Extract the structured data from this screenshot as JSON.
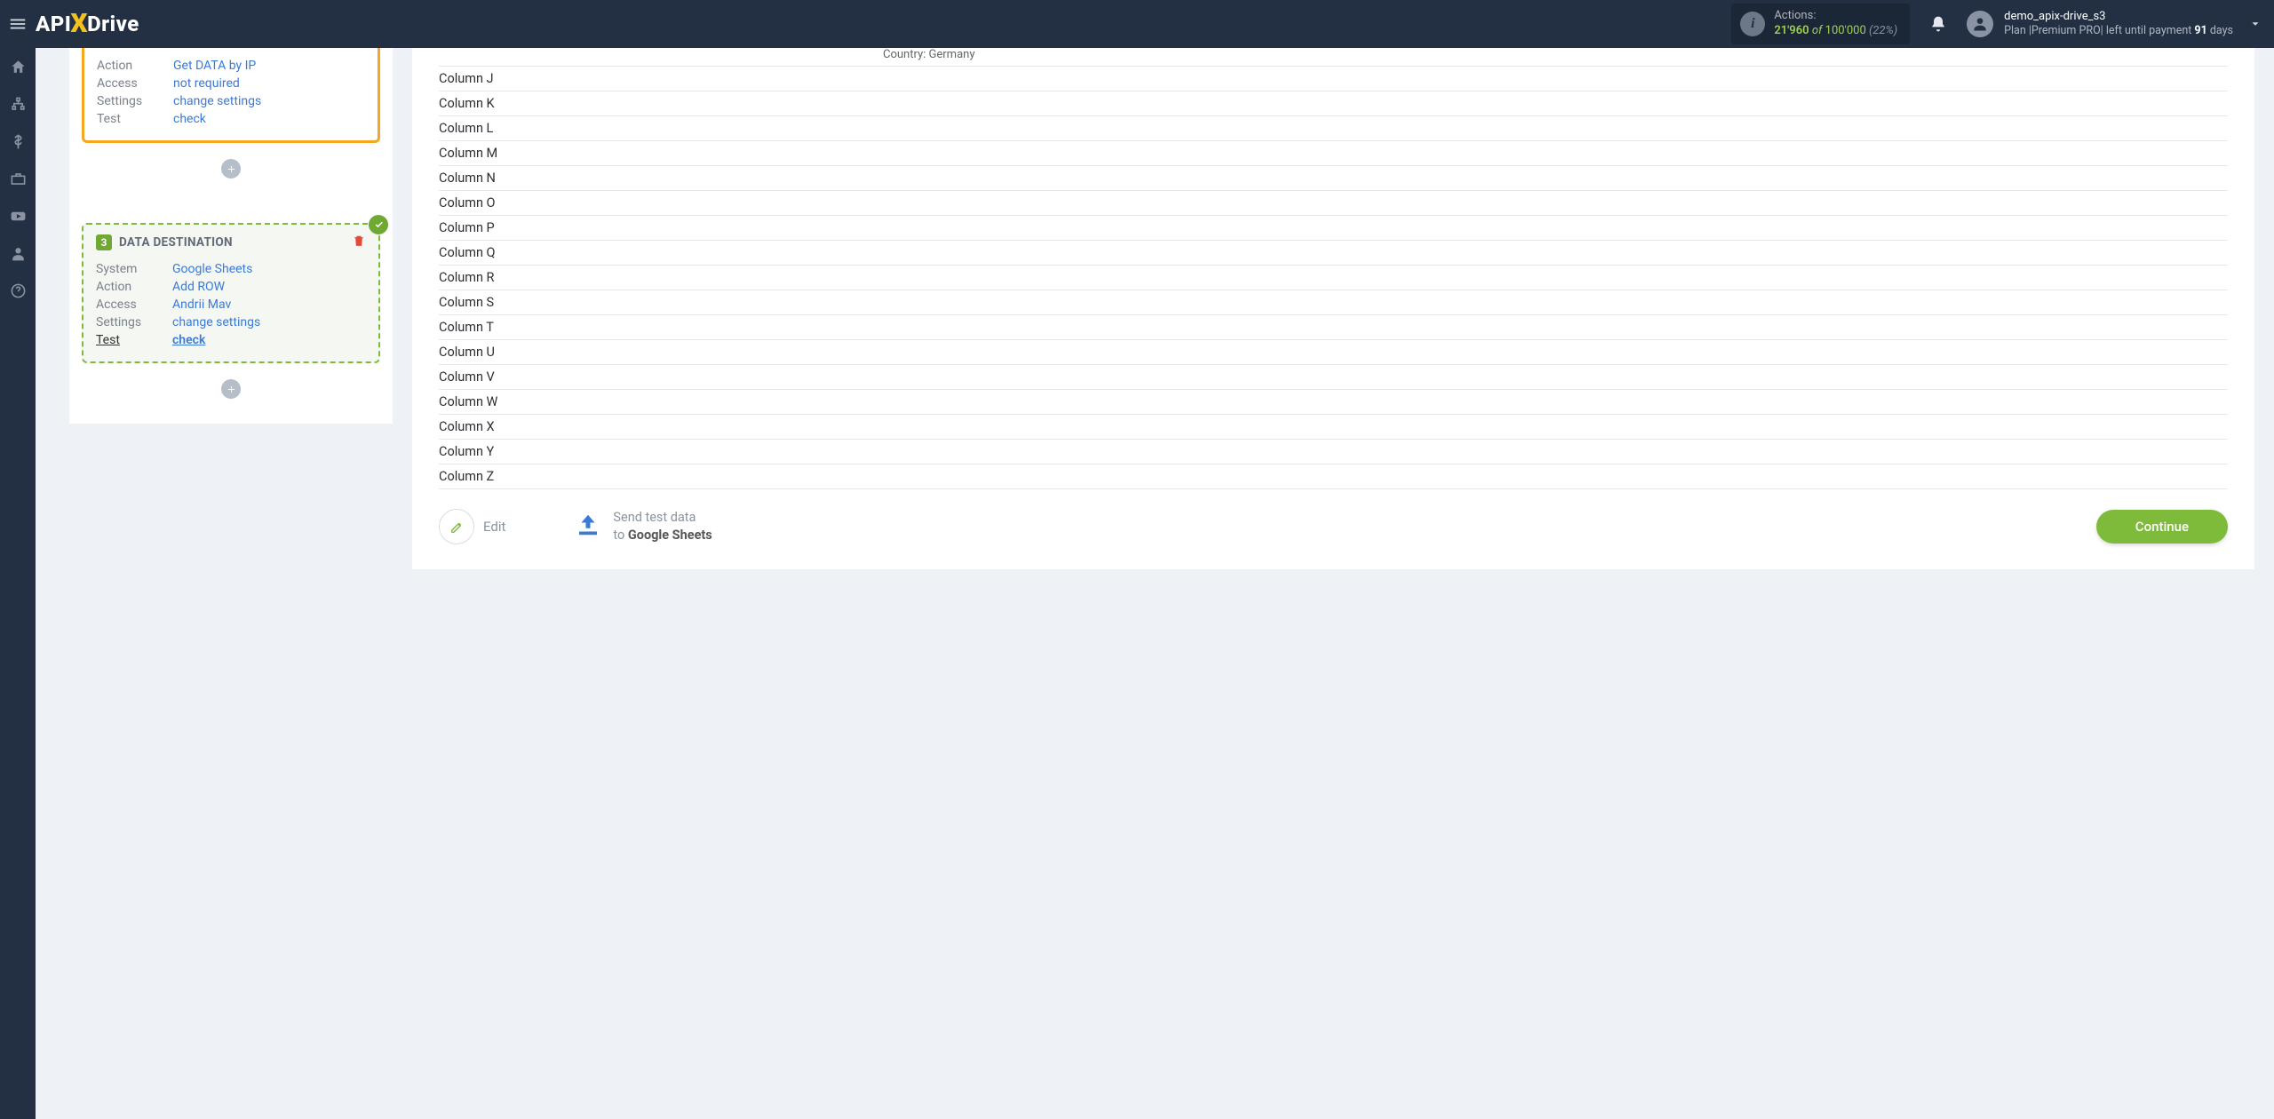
{
  "header": {
    "logo_pre": "API",
    "logo_post": "Drive",
    "actions_label": "Actions:",
    "actions_used": "21'960",
    "actions_of": "of",
    "actions_total": "100'000",
    "actions_pct": "(22%)",
    "user_name": "demo_apix-drive_s3",
    "plan_prefix": "Plan |",
    "plan_name": "Premium PRO",
    "plan_mid": "| left until payment ",
    "plan_days": "91",
    "plan_suffix": " days"
  },
  "left": {
    "card1": {
      "rows": {
        "action_k": "Action",
        "action_v": "Get DATA by IP",
        "access_k": "Access",
        "access_v": "not required",
        "settings_k": "Settings",
        "settings_v": "change settings",
        "test_k": "Test",
        "test_v": "check"
      }
    },
    "card2": {
      "badge": "3",
      "title": "DATA DESTINATION",
      "rows": {
        "system_k": "System",
        "system_v": "Google Sheets",
        "action_k": "Action",
        "action_v": "Add ROW",
        "access_k": "Access",
        "access_v": "Andrii Mav",
        "settings_k": "Settings",
        "settings_v": "change settings",
        "test_k": "Test",
        "test_v": "check"
      }
    }
  },
  "right": {
    "top_row_value": "Country: Germany",
    "columns": [
      "Column J",
      "Column K",
      "Column L",
      "Column M",
      "Column N",
      "Column O",
      "Column P",
      "Column Q",
      "Column R",
      "Column S",
      "Column T",
      "Column U",
      "Column V",
      "Column W",
      "Column X",
      "Column Y",
      "Column Z"
    ],
    "edit_label": "Edit",
    "send_line1": "Send test data",
    "send_line2_prefix": "to ",
    "send_line2_target": "Google Sheets",
    "continue_label": "Continue"
  }
}
